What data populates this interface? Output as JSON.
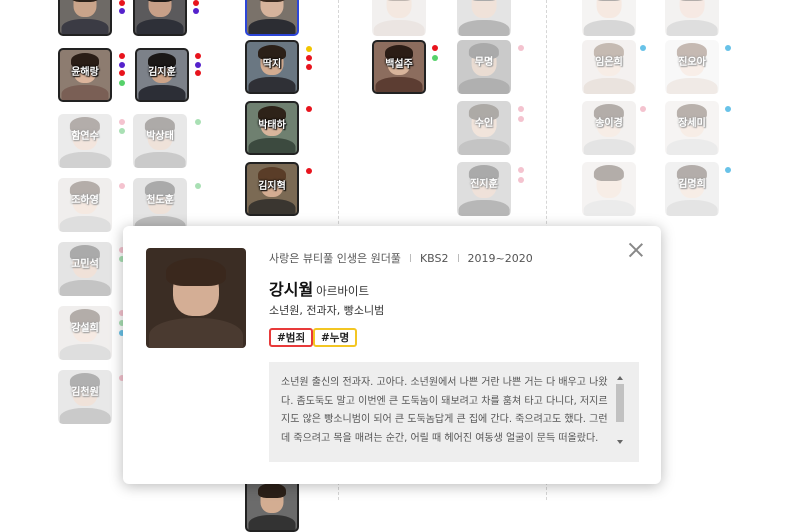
{
  "cards": [
    {
      "id": "c1",
      "name": "",
      "state": "active",
      "skin": "#c9a48a",
      "hair": "#2b2119",
      "shirt": "#3b3b44",
      "bg": "#6e6a66"
    },
    {
      "id": "c2",
      "name": "",
      "state": "active",
      "skin": "#c8a088",
      "hair": "#1e1a18",
      "shirt": "#2e3038",
      "bg": "#5b5a5c"
    },
    {
      "id": "c3",
      "name": "",
      "state": "sel",
      "skin": "#d6b39c",
      "hair": "#3a2a20",
      "shirt": "#2c2d33",
      "bg": "#7a726a"
    },
    {
      "id": "c4",
      "name": "",
      "state": "dim",
      "skin": "#e3c3b0",
      "hair": "#5a4232",
      "shirt": "#cbbdb5",
      "bg": "#dedad6"
    },
    {
      "id": "c5",
      "name": "",
      "state": "dim",
      "skin": "#d8b49c",
      "hair": "#222",
      "shirt": "#444",
      "bg": "#bbb"
    },
    {
      "id": "c6",
      "name": "",
      "state": "dim",
      "skin": "#e8c6b2",
      "hair": "#2f2520",
      "shirt": "#999",
      "bg": "#e6e3e0"
    },
    {
      "id": "c7",
      "name": "",
      "state": "dim",
      "skin": "#e8c8b6",
      "hair": "#3b2b22",
      "shirt": "#aaa",
      "bg": "#e2dedb"
    },
    {
      "id": "c8",
      "name": "윤해랑",
      "state": "active",
      "skin": "#dcb59c",
      "hair": "#2a1d16",
      "shirt": "#7a5f55",
      "bg": "#8d7c70"
    },
    {
      "id": "c9",
      "name": "김지훈",
      "state": "active",
      "skin": "#cda489",
      "hair": "#1b1817",
      "shirt": "#2c2e36",
      "bg": "#7c8189"
    },
    {
      "id": "c10",
      "name": "딱지",
      "state": "active",
      "skin": "#d3ac91",
      "hair": "#2b2018",
      "shirt": "#2f3036",
      "bg": "#6a7782"
    },
    {
      "id": "c11",
      "name": "백설주",
      "state": "active",
      "skin": "#d8b49b",
      "hair": "#2b1d16",
      "shirt": "#5c3d32",
      "bg": "#8c6d5e"
    },
    {
      "id": "c12",
      "name": "무명",
      "state": "dim",
      "skin": "#c9a58c",
      "hair": "#222",
      "shirt": "#333",
      "bg": "#777"
    },
    {
      "id": "c13",
      "name": "임은희",
      "state": "dim",
      "skin": "#ecd0bf",
      "hair": "#6a4b37",
      "shirt": "#c9b7aa",
      "bg": "#e4ddd8"
    },
    {
      "id": "c14",
      "name": "진오아",
      "state": "dim",
      "skin": "#efd4c4",
      "hair": "#6a4a38",
      "shirt": "#d9c9bf",
      "bg": "#eee"
    },
    {
      "id": "c15",
      "name": "함연수",
      "state": "dim",
      "skin": "#e0bda8",
      "hair": "#3a2a22",
      "shirt": "#888",
      "bg": "#ccc"
    },
    {
      "id": "c16",
      "name": "박상태",
      "state": "dim",
      "skin": "#d7b49e",
      "hair": "#2a211c",
      "shirt": "#777",
      "bg": "#c4c4c4"
    },
    {
      "id": "c17",
      "name": "박태하",
      "state": "active",
      "skin": "#d9b59c",
      "hair": "#2e2319",
      "shirt": "#3c4a3f",
      "bg": "#6f8070"
    },
    {
      "id": "c18",
      "name": "수인",
      "state": "dim",
      "skin": "#dcb9a2",
      "hair": "#2b2119",
      "shirt": "#666",
      "bg": "#999"
    },
    {
      "id": "c19",
      "name": "송이경",
      "state": "dim",
      "skin": "#ecd0bf",
      "hair": "#3b2a20",
      "shirt": "#bbb",
      "bg": "#e0dcd8"
    },
    {
      "id": "c20",
      "name": "장세미",
      "state": "dim",
      "skin": "#ecd0bf",
      "hair": "#4a3528",
      "shirt": "#ccc",
      "bg": "#e8e4e0"
    },
    {
      "id": "c21",
      "name": "조하영",
      "state": "dim",
      "skin": "#e6c6b2",
      "hair": "#3c2b20",
      "shirt": "#aaa",
      "bg": "#d8d4d0"
    },
    {
      "id": "c22",
      "name": "천도훈",
      "state": "dim",
      "skin": "#d5b29b",
      "hair": "#222",
      "shirt": "#555",
      "bg": "#bbb"
    },
    {
      "id": "c23",
      "name": "김지혁",
      "state": "active",
      "skin": "#d4ad92",
      "hair": "#5a3d28",
      "shirt": "#3a3630",
      "bg": "#7b6a54"
    },
    {
      "id": "c24",
      "name": "진지훈",
      "state": "dim",
      "skin": "#d7b39c",
      "hair": "#222",
      "shirt": "#444",
      "bg": "#a9a9a9"
    },
    {
      "id": "c25",
      "name": "",
      "state": "dim",
      "skin": "#ecd0bf",
      "hair": "#3b2a20",
      "shirt": "#ccc",
      "bg": "#e6e2de"
    },
    {
      "id": "c26",
      "name": "김명희",
      "state": "dim",
      "skin": "#ecd0bf",
      "hair": "#3b2b22",
      "shirt": "#bbb",
      "bg": "#ddd"
    },
    {
      "id": "c27",
      "name": "고민석",
      "state": "dim",
      "skin": "#d8b39b",
      "hair": "#222",
      "shirt": "#666",
      "bg": "#bbb"
    },
    {
      "id": "c28",
      "name": "강설희",
      "state": "dim",
      "skin": "#e9cab7",
      "hair": "#3b2a20",
      "shirt": "#aaa",
      "bg": "#d8d4d0"
    },
    {
      "id": "c29",
      "name": "김천원",
      "state": "dim",
      "skin": "#d9b59e",
      "hair": "#333",
      "shirt": "#777",
      "bg": "#c4c4c4"
    },
    {
      "id": "c30",
      "name": "",
      "state": "active",
      "skin": "#d3ad92",
      "hair": "#2b2018",
      "shirt": "#333",
      "bg": "#6b6b6b"
    }
  ],
  "dots": {
    "red": "#e8141d",
    "purple": "#5522cc",
    "yellow": "#f2c500",
    "green": "#56d16a",
    "pink": "#f0a0b4",
    "blue": "#68c2e8",
    "ltgreen": "#a9e0b4",
    "ltpink": "#f4c3cf"
  },
  "detail": {
    "drama_title": "사랑은 뷰티풀 인생은 원더풀",
    "network": "KBS2",
    "years": "2019~2020",
    "name": "강시월",
    "role": "아르바이트",
    "tags_line": "소년원, 전과자, 빵소니범",
    "hashtags": [
      "#범죄",
      "#누명"
    ],
    "description": "소년원 출신의 전과자. 고아다. 소년원에서 나쁜 거란 나쁜 거는 다 배우고 나왔다. 좀도둑도 말고 이번엔 큰 도둑놈이 돼보려고 차를 훔쳐 타고 다니다, 저지르지도 않은 빵소니범이 되어 큰 도둑놈답게 큰 집에 간다. 죽으려고도 했다. 그런데 죽으려고 목을 매려는 순간, 어릴 때 헤어진 여동생 얼굴이 문득 떠올랐다."
  }
}
